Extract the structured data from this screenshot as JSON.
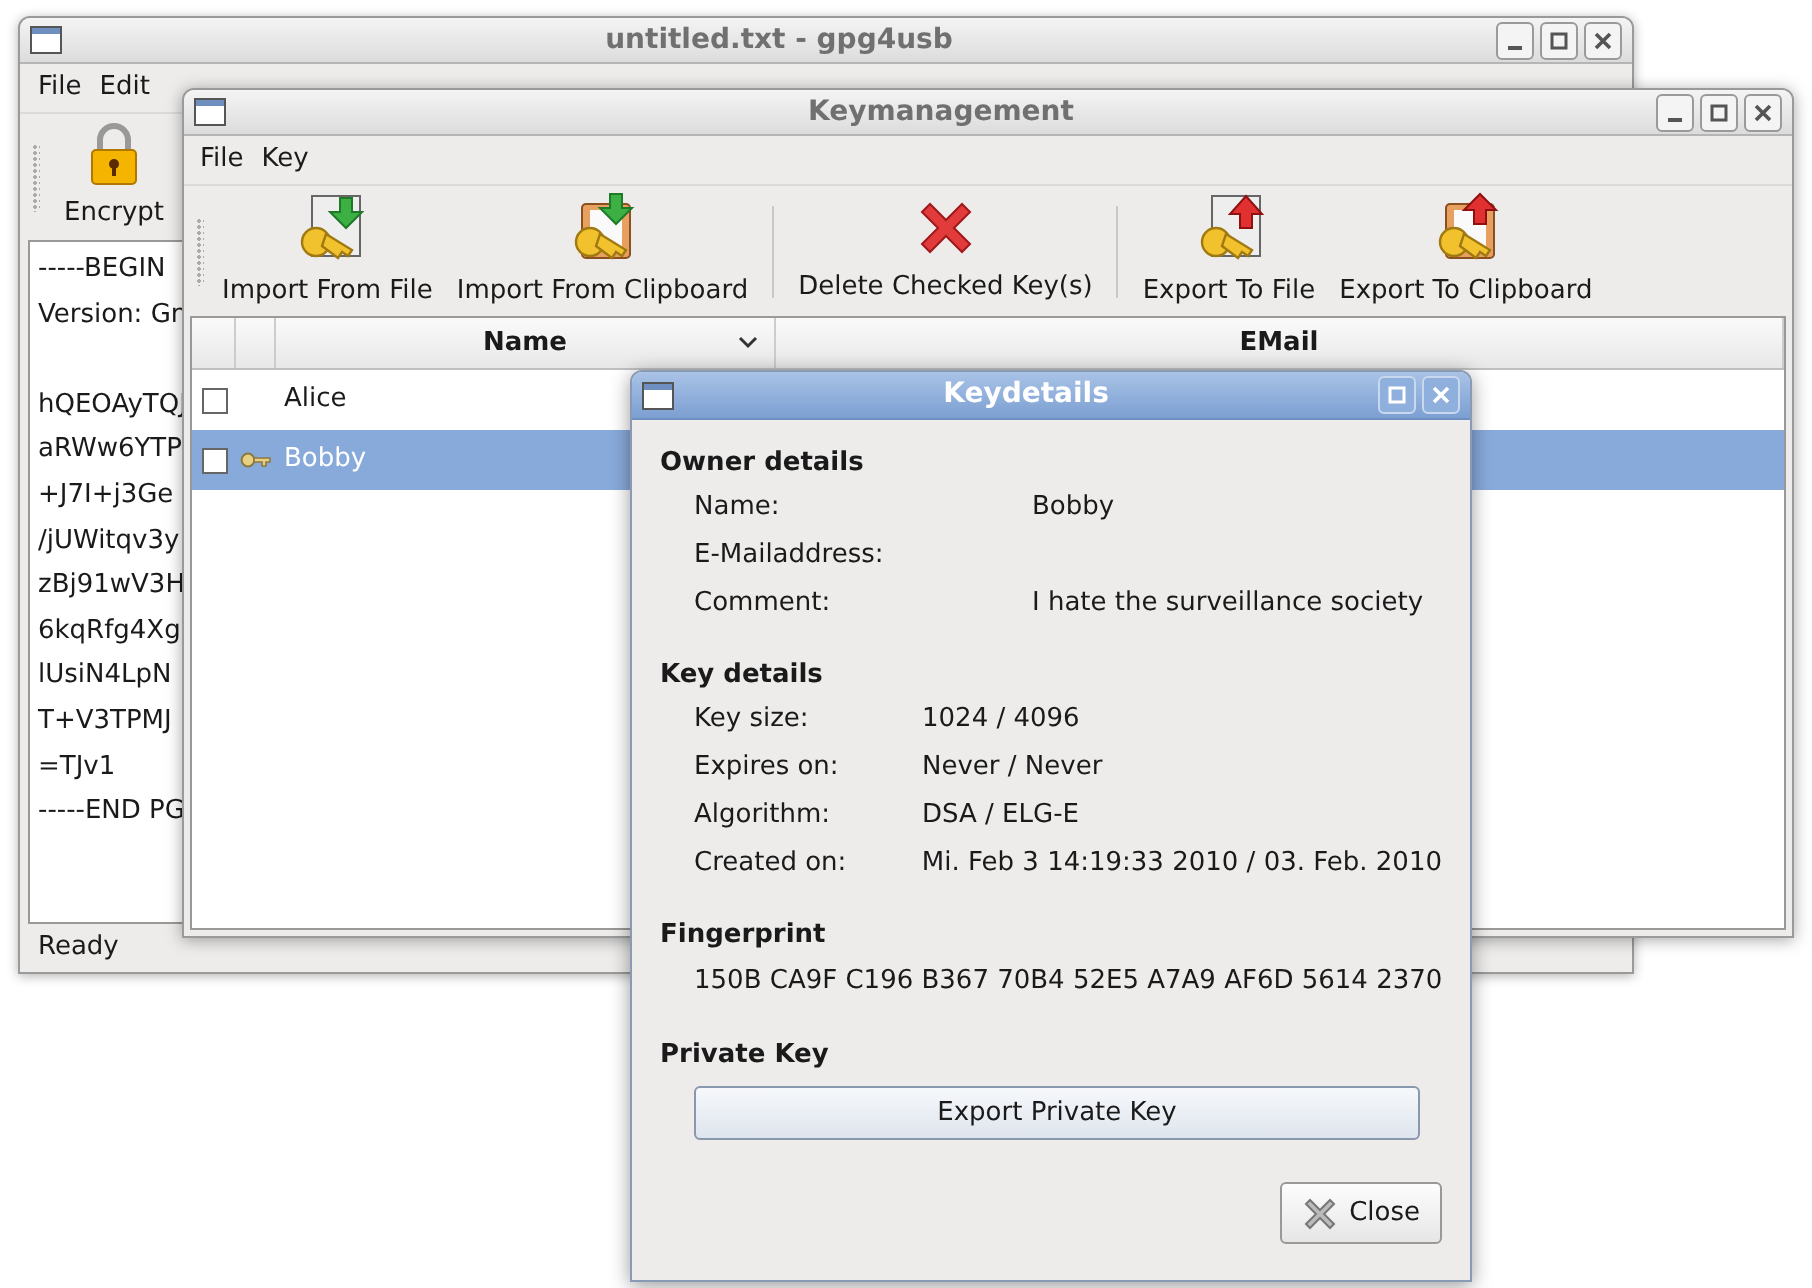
{
  "main_window": {
    "title": "untitled.txt - gpg4usb",
    "menu": [
      "File",
      "Edit"
    ],
    "toolbar": [
      {
        "label": "Encrypt",
        "kind": "lock"
      }
    ],
    "editor_paragraphs": [
      [
        "-----BEGIN",
        "Version: Gn"
      ],
      [
        "hQEOAyTQJ",
        "aRWw6YTP",
        "+J7I+j3Ge",
        "/jUWitqv3y",
        "zBj91wV3H",
        "6kqRfg4Xg",
        "lUsiN4LpN",
        "T+V3TPMJ",
        "=TJv1",
        "-----END PG"
      ]
    ],
    "status_bar": "Ready"
  },
  "keymanagement": {
    "title": "Keymanagement",
    "menu": [
      "File",
      "Key"
    ],
    "toolbar_groups": [
      [
        {
          "label": "Import From File",
          "kind": "import-file"
        },
        {
          "label": "Import From Clipboard",
          "kind": "import-clipboard"
        }
      ],
      [
        {
          "label": "Delete Checked Key(s)",
          "kind": "delete"
        }
      ],
      [
        {
          "label": "Export To File",
          "kind": "export-file"
        },
        {
          "label": "Export To Clipboard",
          "kind": "export-clipboard"
        }
      ]
    ],
    "table": {
      "columns": [
        {
          "label": "Name",
          "sorted": true
        },
        {
          "label": "EMail",
          "sorted": false
        }
      ],
      "rows": [
        {
          "name": "Alice",
          "checked": false,
          "selected": false,
          "secret": false
        },
        {
          "name": "Bobby",
          "checked": false,
          "selected": true,
          "secret": true
        }
      ]
    }
  },
  "keydetails": {
    "title": "Keydetails",
    "sections": [
      {
        "heading": "Owner details",
        "kind": "wide-fields",
        "fields": [
          {
            "label": "Name:",
            "value": "Bobby"
          },
          {
            "label": "E-Mailaddress:"
          },
          {
            "label": "Comment:",
            "value": "I hate the surveillance society"
          }
        ]
      },
      {
        "heading": "Key details",
        "kind": "fields",
        "fields": [
          {
            "label": "Key size:",
            "value": "1024 / 4096"
          },
          {
            "label": "Expires on:",
            "value": "Never / Never"
          },
          {
            "label": "Algorithm:",
            "value": "DSA / ELG-E"
          },
          {
            "label": "Created on:",
            "value": "Mi. Feb 3 14:19:33 2010 / 03. Feb. 2010"
          }
        ]
      },
      {
        "heading": "Fingerprint",
        "kind": "text",
        "text": "150B CA9F C196 B367 70B4 52E5 A7A9 AF6D 5614 2370"
      },
      {
        "heading": "Private Key",
        "kind": "button",
        "button": "Export Private Key"
      }
    ],
    "close_button": "Close"
  }
}
